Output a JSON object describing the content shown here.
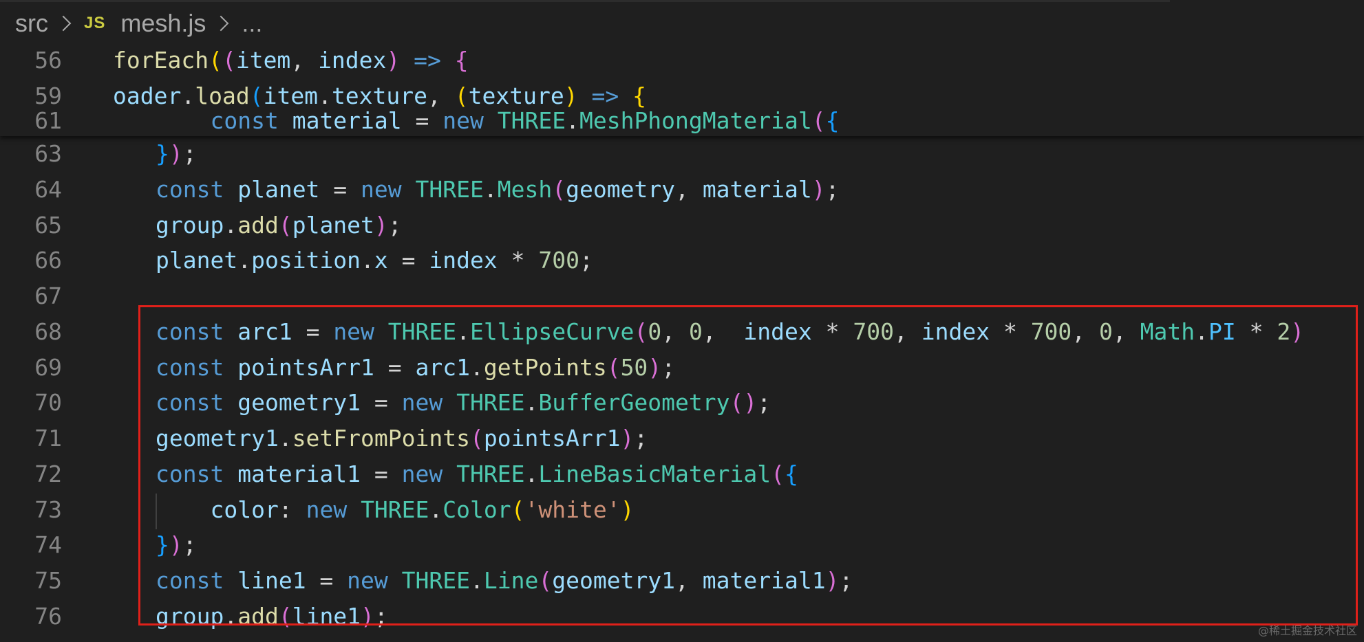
{
  "breadcrumb": {
    "folder": "src",
    "file_icon": "JS",
    "file": "mesh.js",
    "more": "..."
  },
  "sticky_lines": [
    {
      "number": "56",
      "tokens": [
        {
          "t": "forEach",
          "c": "fn"
        },
        {
          "t": "(",
          "c": "p1"
        },
        {
          "t": "(",
          "c": "p2"
        },
        {
          "t": "item",
          "c": "vr"
        },
        {
          "t": ", ",
          "c": "op"
        },
        {
          "t": "index",
          "c": "vr"
        },
        {
          "t": ")",
          "c": "p2"
        },
        {
          "t": " ",
          "c": "op"
        },
        {
          "t": "=>",
          "c": "kw"
        },
        {
          "t": " ",
          "c": "op"
        },
        {
          "t": "{",
          "c": "p2"
        }
      ]
    },
    {
      "number": "59",
      "tokens": [
        {
          "t": "oader",
          "c": "vr"
        },
        {
          "t": ".",
          "c": "op"
        },
        {
          "t": "load",
          "c": "fn"
        },
        {
          "t": "(",
          "c": "p3"
        },
        {
          "t": "item",
          "c": "vr"
        },
        {
          "t": ".",
          "c": "op"
        },
        {
          "t": "texture",
          "c": "vr"
        },
        {
          "t": ", ",
          "c": "op"
        },
        {
          "t": "(",
          "c": "p1"
        },
        {
          "t": "texture",
          "c": "vr"
        },
        {
          "t": ")",
          "c": "p1"
        },
        {
          "t": " ",
          "c": "op"
        },
        {
          "t": "=>",
          "c": "kw"
        },
        {
          "t": " ",
          "c": "op"
        },
        {
          "t": "{",
          "c": "p1"
        }
      ]
    },
    {
      "number": "61",
      "tokens": [
        {
          "t": "    ",
          "c": "op"
        },
        {
          "t": "const",
          "c": "kw"
        },
        {
          "t": " ",
          "c": "op"
        },
        {
          "t": "material",
          "c": "vr"
        },
        {
          "t": " = ",
          "c": "op"
        },
        {
          "t": "new",
          "c": "kw"
        },
        {
          "t": " ",
          "c": "op"
        },
        {
          "t": "THREE",
          "c": "cls"
        },
        {
          "t": ".",
          "c": "op"
        },
        {
          "t": "MeshPhongMaterial",
          "c": "cls"
        },
        {
          "t": "(",
          "c": "p2"
        },
        {
          "t": "{",
          "c": "p3"
        }
      ]
    }
  ],
  "code_lines": [
    {
      "number": "63",
      "tokens": [
        {
          "t": "}",
          "c": "p3"
        },
        {
          "t": ")",
          "c": "p2"
        },
        {
          "t": ";",
          "c": "op"
        }
      ]
    },
    {
      "number": "64",
      "tokens": [
        {
          "t": "const",
          "c": "kw"
        },
        {
          "t": " ",
          "c": "op"
        },
        {
          "t": "planet",
          "c": "vr"
        },
        {
          "t": " = ",
          "c": "op"
        },
        {
          "t": "new",
          "c": "kw"
        },
        {
          "t": " ",
          "c": "op"
        },
        {
          "t": "THREE",
          "c": "cls"
        },
        {
          "t": ".",
          "c": "op"
        },
        {
          "t": "Mesh",
          "c": "cls"
        },
        {
          "t": "(",
          "c": "p2"
        },
        {
          "t": "geometry",
          "c": "vr"
        },
        {
          "t": ", ",
          "c": "op"
        },
        {
          "t": "material",
          "c": "vr"
        },
        {
          "t": ")",
          "c": "p2"
        },
        {
          "t": ";",
          "c": "op"
        }
      ]
    },
    {
      "number": "65",
      "tokens": [
        {
          "t": "group",
          "c": "vr"
        },
        {
          "t": ".",
          "c": "op"
        },
        {
          "t": "add",
          "c": "fn"
        },
        {
          "t": "(",
          "c": "p2"
        },
        {
          "t": "planet",
          "c": "vr"
        },
        {
          "t": ")",
          "c": "p2"
        },
        {
          "t": ";",
          "c": "op"
        }
      ]
    },
    {
      "number": "66",
      "tokens": [
        {
          "t": "planet",
          "c": "vr"
        },
        {
          "t": ".",
          "c": "op"
        },
        {
          "t": "position",
          "c": "vr"
        },
        {
          "t": ".",
          "c": "op"
        },
        {
          "t": "x",
          "c": "vr"
        },
        {
          "t": " = ",
          "c": "op"
        },
        {
          "t": "index",
          "c": "vr"
        },
        {
          "t": " * ",
          "c": "op"
        },
        {
          "t": "700",
          "c": "num"
        },
        {
          "t": ";",
          "c": "op"
        }
      ]
    },
    {
      "number": "67",
      "tokens": []
    },
    {
      "number": "68",
      "tokens": [
        {
          "t": "const",
          "c": "kw"
        },
        {
          "t": " ",
          "c": "op"
        },
        {
          "t": "arc1",
          "c": "vr"
        },
        {
          "t": " = ",
          "c": "op"
        },
        {
          "t": "new",
          "c": "kw"
        },
        {
          "t": " ",
          "c": "op"
        },
        {
          "t": "THREE",
          "c": "cls"
        },
        {
          "t": ".",
          "c": "op"
        },
        {
          "t": "EllipseCurve",
          "c": "cls"
        },
        {
          "t": "(",
          "c": "p2"
        },
        {
          "t": "0",
          "c": "num"
        },
        {
          "t": ", ",
          "c": "op"
        },
        {
          "t": "0",
          "c": "num"
        },
        {
          "t": ",  ",
          "c": "op"
        },
        {
          "t": "index",
          "c": "vr"
        },
        {
          "t": " * ",
          "c": "op"
        },
        {
          "t": "700",
          "c": "num"
        },
        {
          "t": ", ",
          "c": "op"
        },
        {
          "t": "index",
          "c": "vr"
        },
        {
          "t": " * ",
          "c": "op"
        },
        {
          "t": "700",
          "c": "num"
        },
        {
          "t": ", ",
          "c": "op"
        },
        {
          "t": "0",
          "c": "num"
        },
        {
          "t": ", ",
          "c": "op"
        },
        {
          "t": "Math",
          "c": "cls"
        },
        {
          "t": ".",
          "c": "op"
        },
        {
          "t": "PI",
          "c": "cn"
        },
        {
          "t": " * ",
          "c": "op"
        },
        {
          "t": "2",
          "c": "num"
        },
        {
          "t": ")",
          "c": "p2"
        }
      ]
    },
    {
      "number": "69",
      "tokens": [
        {
          "t": "const",
          "c": "kw"
        },
        {
          "t": " ",
          "c": "op"
        },
        {
          "t": "pointsArr1",
          "c": "vr"
        },
        {
          "t": " = ",
          "c": "op"
        },
        {
          "t": "arc1",
          "c": "vr"
        },
        {
          "t": ".",
          "c": "op"
        },
        {
          "t": "getPoints",
          "c": "fn"
        },
        {
          "t": "(",
          "c": "p2"
        },
        {
          "t": "50",
          "c": "num"
        },
        {
          "t": ")",
          "c": "p2"
        },
        {
          "t": ";",
          "c": "op"
        }
      ]
    },
    {
      "number": "70",
      "tokens": [
        {
          "t": "const",
          "c": "kw"
        },
        {
          "t": " ",
          "c": "op"
        },
        {
          "t": "geometry1",
          "c": "vr"
        },
        {
          "t": " = ",
          "c": "op"
        },
        {
          "t": "new",
          "c": "kw"
        },
        {
          "t": " ",
          "c": "op"
        },
        {
          "t": "THREE",
          "c": "cls"
        },
        {
          "t": ".",
          "c": "op"
        },
        {
          "t": "BufferGeometry",
          "c": "cls"
        },
        {
          "t": "(",
          "c": "p2"
        },
        {
          "t": ")",
          "c": "p2"
        },
        {
          "t": ";",
          "c": "op"
        }
      ]
    },
    {
      "number": "71",
      "tokens": [
        {
          "t": "geometry1",
          "c": "vr"
        },
        {
          "t": ".",
          "c": "op"
        },
        {
          "t": "setFromPoints",
          "c": "fn"
        },
        {
          "t": "(",
          "c": "p2"
        },
        {
          "t": "pointsArr1",
          "c": "vr"
        },
        {
          "t": ")",
          "c": "p2"
        },
        {
          "t": ";",
          "c": "op"
        }
      ]
    },
    {
      "number": "72",
      "tokens": [
        {
          "t": "const",
          "c": "kw"
        },
        {
          "t": " ",
          "c": "op"
        },
        {
          "t": "material1",
          "c": "vr"
        },
        {
          "t": " = ",
          "c": "op"
        },
        {
          "t": "new",
          "c": "kw"
        },
        {
          "t": " ",
          "c": "op"
        },
        {
          "t": "THREE",
          "c": "cls"
        },
        {
          "t": ".",
          "c": "op"
        },
        {
          "t": "LineBasicMaterial",
          "c": "cls"
        },
        {
          "t": "(",
          "c": "p2"
        },
        {
          "t": "{",
          "c": "p3"
        }
      ]
    },
    {
      "number": "73",
      "tokens": [
        {
          "t": "    ",
          "c": "op"
        },
        {
          "t": "color",
          "c": "vr"
        },
        {
          "t": ": ",
          "c": "op"
        },
        {
          "t": "new",
          "c": "kw"
        },
        {
          "t": " ",
          "c": "op"
        },
        {
          "t": "THREE",
          "c": "cls"
        },
        {
          "t": ".",
          "c": "op"
        },
        {
          "t": "Color",
          "c": "cls"
        },
        {
          "t": "(",
          "c": "p1"
        },
        {
          "t": "'white'",
          "c": "str"
        },
        {
          "t": ")",
          "c": "p1"
        }
      ]
    },
    {
      "number": "74",
      "tokens": [
        {
          "t": "}",
          "c": "p3"
        },
        {
          "t": ")",
          "c": "p2"
        },
        {
          "t": ";",
          "c": "op"
        }
      ]
    },
    {
      "number": "75",
      "tokens": [
        {
          "t": "const",
          "c": "kw"
        },
        {
          "t": " ",
          "c": "op"
        },
        {
          "t": "line1",
          "c": "vr"
        },
        {
          "t": " = ",
          "c": "op"
        },
        {
          "t": "new",
          "c": "kw"
        },
        {
          "t": " ",
          "c": "op"
        },
        {
          "t": "THREE",
          "c": "cls"
        },
        {
          "t": ".",
          "c": "op"
        },
        {
          "t": "Line",
          "c": "cls"
        },
        {
          "t": "(",
          "c": "p2"
        },
        {
          "t": "geometry1",
          "c": "vr"
        },
        {
          "t": ", ",
          "c": "op"
        },
        {
          "t": "material1",
          "c": "vr"
        },
        {
          "t": ")",
          "c": "p2"
        },
        {
          "t": ";",
          "c": "op"
        }
      ]
    },
    {
      "number": "76",
      "tokens": [
        {
          "t": "group",
          "c": "vr"
        },
        {
          "t": ".",
          "c": "op"
        },
        {
          "t": "add",
          "c": "fn"
        },
        {
          "t": "(",
          "c": "p2"
        },
        {
          "t": "line1",
          "c": "vr"
        },
        {
          "t": ")",
          "c": "p2"
        },
        {
          "t": ";",
          "c": "op"
        }
      ]
    }
  ],
  "highlight_color": "#e0201a",
  "watermark": "@稀土掘金技术社区"
}
